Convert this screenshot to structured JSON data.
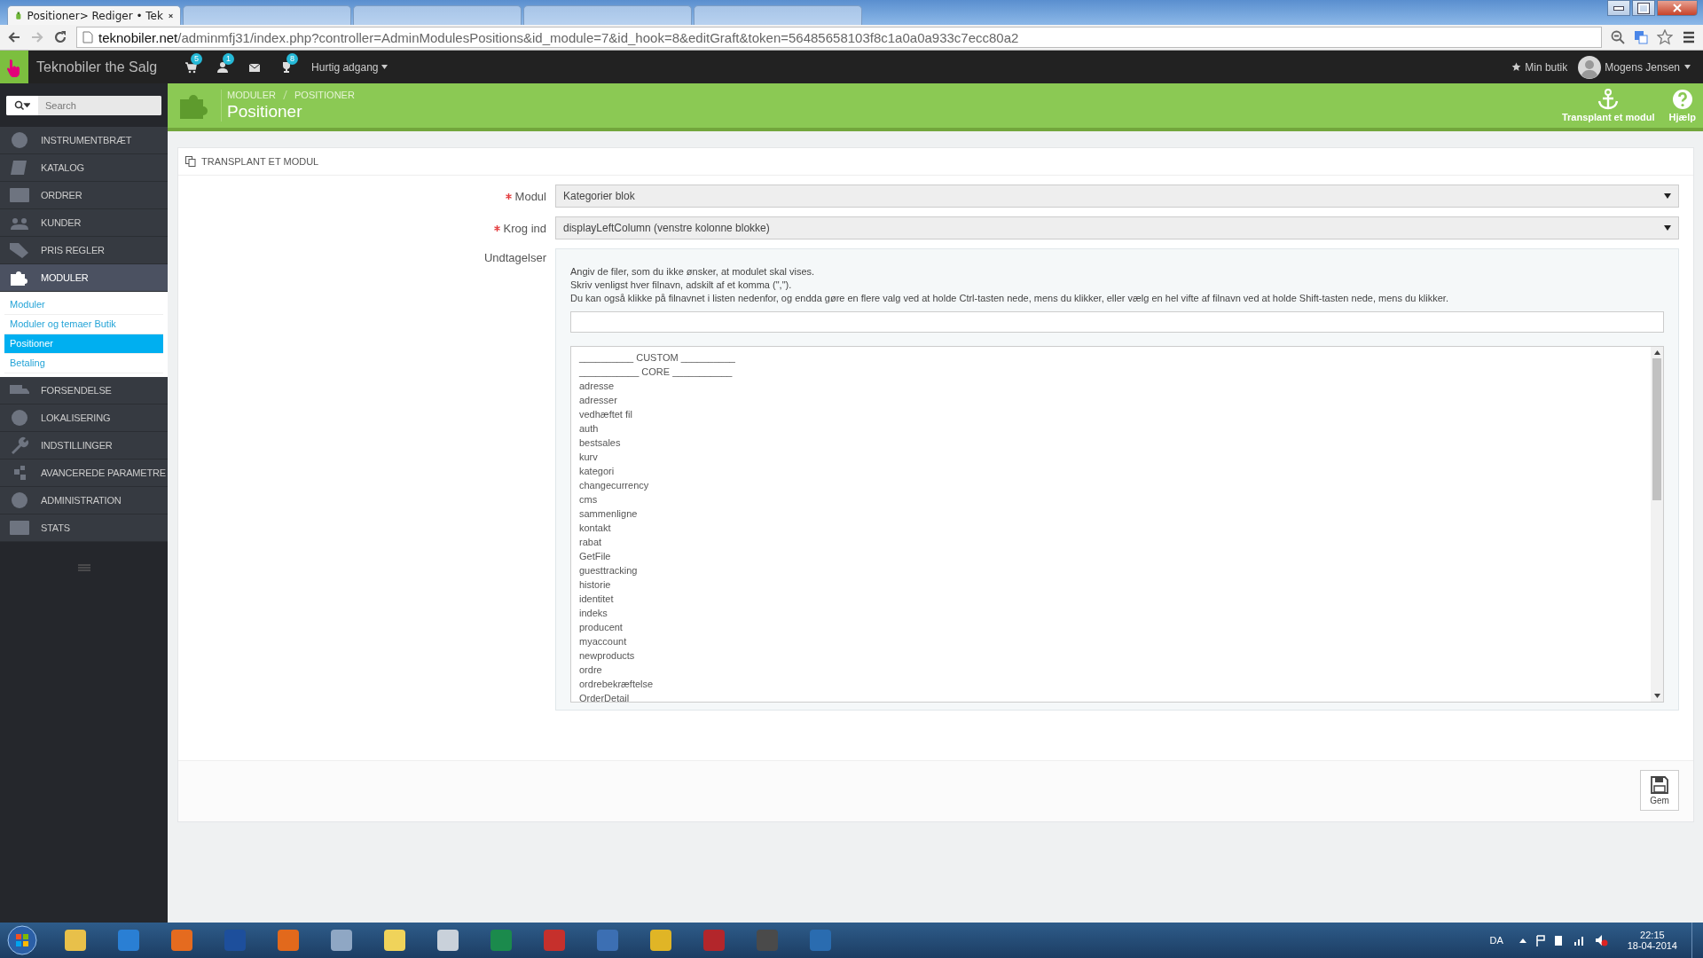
{
  "browser": {
    "tabs": [
      {
        "title": "Positioner> Rediger • Tek",
        "selected": true
      },
      {
        "selected": false
      },
      {
        "selected": false
      },
      {
        "selected": false
      },
      {
        "selected": false
      }
    ],
    "url_host": "teknobiler.net",
    "url_path": "/adminmfj31/index.php?controller=AdminModulesPositions&id_module=7&id_hook=8&editGraft&token=56485658103f8c1a0a0a933c7ecc80a2"
  },
  "topbar": {
    "shop_name": "Teknobiler the Salg",
    "notifications": [
      {
        "kind": "cart",
        "count": "5"
      },
      {
        "kind": "person",
        "count": "1"
      },
      {
        "kind": "mail"
      },
      {
        "kind": "trophy",
        "count": "8"
      }
    ],
    "quick_access": "Hurtig adgang",
    "my_shop": "Min butik",
    "user_name": "Mogens Jensen"
  },
  "search": {
    "placeholder": "Search"
  },
  "page_header": {
    "breadcrumb": [
      "MODULER",
      "POSITIONER"
    ],
    "title": "Positioner",
    "actions": [
      {
        "kind": "anchor",
        "label": "Transplant et modul"
      },
      {
        "kind": "help",
        "label": "Hjælp"
      }
    ]
  },
  "sidebar": {
    "items": [
      {
        "label": "INSTRUMENTBRÆT",
        "selected": false
      },
      {
        "label": "KATALOG",
        "selected": false
      },
      {
        "label": "ORDRER",
        "selected": false
      },
      {
        "label": "KUNDER",
        "selected": false
      },
      {
        "label": "PRIS REGLER",
        "selected": false
      },
      {
        "label": "MODULER",
        "selected": true,
        "children": [
          {
            "label": "Moduler",
            "selected": false
          },
          {
            "label": "Moduler og temaer Butik",
            "selected": false
          },
          {
            "label": "Positioner",
            "selected": true
          },
          {
            "label": "Betaling",
            "selected": false
          }
        ]
      },
      {
        "label": "FORSENDELSE",
        "selected": false
      },
      {
        "label": "LOKALISERING",
        "selected": false
      },
      {
        "label": "INDSTILLINGER",
        "selected": false
      },
      {
        "label": "AVANCEREDE PARAMETRE",
        "selected": false
      },
      {
        "label": "ADMINISTRATION",
        "selected": false
      },
      {
        "label": "STATS",
        "selected": false
      }
    ]
  },
  "form": {
    "panel_title": "TRANSPLANT ET MODUL",
    "module": {
      "label": "Modul",
      "required": true,
      "value": "Kategorier blok"
    },
    "hook": {
      "label": "Krog ind",
      "required": true,
      "value": "displayLeftColumn (venstre kolonne blokke)"
    },
    "exceptions": {
      "label": "Undtagelser",
      "help": [
        "Angiv de filer, som du ikke ønsker, at modulet skal vises.",
        "Skriv venligst hver filnavn, adskilt af et komma (\",\").",
        "Du kan også klikke på filnavnet i listen nedenfor, og endda gøre en flere valg ved at holde Ctrl-tasten nede, mens du klikker, eller vælg en hel vifte af filnavn ved at holde Shift-tasten nede, mens du klikker."
      ],
      "list": [
        "__________ CUSTOM __________",
        "___________ CORE ___________",
        "adresse",
        "adresser",
        "vedhæftet fil",
        "auth",
        "bestsales",
        "kurv",
        "kategori",
        "changecurrency",
        "cms",
        "sammenligne",
        "kontakt",
        "rabat",
        "GetFile",
        "guesttracking",
        "historie",
        "identitet",
        "indeks",
        "producent",
        "myaccount",
        "newproducts",
        "ordre",
        "ordrebekræftelse",
        "OrderDetail"
      ]
    },
    "save_label": "Gem"
  },
  "taskbar": {
    "language": "DA",
    "time": "22:15",
    "date": "18-04-2014"
  }
}
